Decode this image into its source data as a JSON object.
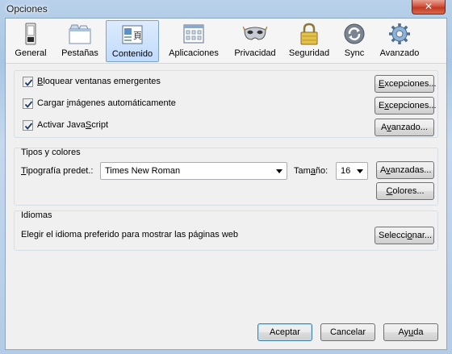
{
  "window": {
    "title": "Opciones",
    "close_glyph": "✕"
  },
  "tabs": [
    {
      "label": "General",
      "icon": "general-icon"
    },
    {
      "label": "Pestañas",
      "icon": "tabs-icon"
    },
    {
      "label": "Contenido",
      "icon": "content-icon",
      "active": true
    },
    {
      "label": "Aplicaciones",
      "icon": "applications-icon"
    },
    {
      "label": "Privacidad",
      "icon": "privacy-mask-icon"
    },
    {
      "label": "Seguridad",
      "icon": "security-lock-icon"
    },
    {
      "label": "Sync",
      "icon": "sync-icon"
    },
    {
      "label": "Avanzado",
      "icon": "advanced-gear-icon"
    }
  ],
  "content": {
    "checks": [
      {
        "label_u": "B",
        "label_rest": "loquear ventanas emergentes",
        "checked": true,
        "button_u": "E",
        "button_rest": "xcepciones..."
      },
      {
        "label_pre": "Cargar ",
        "label_u": "i",
        "label_rest": "mágenes automáticamente",
        "checked": true,
        "button_u": "x",
        "button_pre": "E",
        "button_rest": "cepciones..."
      },
      {
        "label_pre": "Activar Java",
        "label_u": "S",
        "label_rest": "cript",
        "checked": true,
        "button_pre": "A",
        "button_u": "v",
        "button_rest": "anzado..."
      }
    ],
    "fonts_colors": {
      "title": "Tipos y colores",
      "font_label_u": "T",
      "font_label_rest": "ipografía predet.:",
      "font_value": "Times New Roman",
      "size_label_pre": "Tam",
      "size_label_u": "a",
      "size_label_rest": "ño:",
      "size_value": "16",
      "advanced_pre": "A",
      "advanced_u": "v",
      "advanced_rest": "anzadas...",
      "colors_u": "C",
      "colors_rest": "olores..."
    },
    "languages": {
      "title": "Idiomas",
      "description": "Elegir el idioma preferido para mostrar las páginas web",
      "select_pre": "Selecci",
      "select_u": "o",
      "select_rest": "nar..."
    }
  },
  "footer": {
    "accept": "Aceptar",
    "cancel": "Cancelar",
    "help_pre": "Ay",
    "help_u": "u",
    "help_rest": "da"
  },
  "colors": {
    "active_tab": "#c1dbfc",
    "default_button_border": "#3c7fb1"
  }
}
